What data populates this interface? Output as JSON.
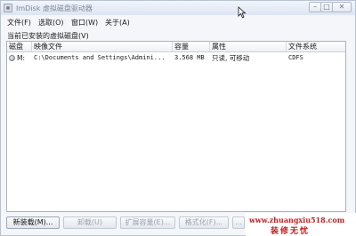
{
  "window": {
    "title": "ImDisk 虚拟磁盘驱动器"
  },
  "titlebar_buttons": {
    "minimize": "–",
    "maximize": "□",
    "close": "✕"
  },
  "menu": {
    "file": "文件(F)",
    "options": "选取(O)",
    "window": "窗口(W)",
    "about": "关于(A)"
  },
  "section_label": "当前已安装的虚拟磁盘(V)",
  "list": {
    "columns": [
      "磁盘",
      "映像文件",
      "容量",
      "属性",
      "文件系统"
    ],
    "rows": [
      {
        "drive": "M:",
        "image_file": "C:\\Documents and Settings\\Admini...",
        "size": "3.568 MB",
        "attributes": "只读, 可移动",
        "filesystem": "CDFS"
      }
    ]
  },
  "buttons": {
    "new_mount": "新装载(M)...",
    "unmount": "卸载(U)",
    "extend": "扩展容量(E)...",
    "format": "格式化(F)...",
    "more": "..."
  },
  "watermark": {
    "url": "www.zhuangxiu518.com",
    "name": "装修无忧"
  },
  "icons": {
    "app": "disk-app-icon",
    "drive": "cd-disk-icon",
    "cursor": "mouse-pointer-icon"
  }
}
